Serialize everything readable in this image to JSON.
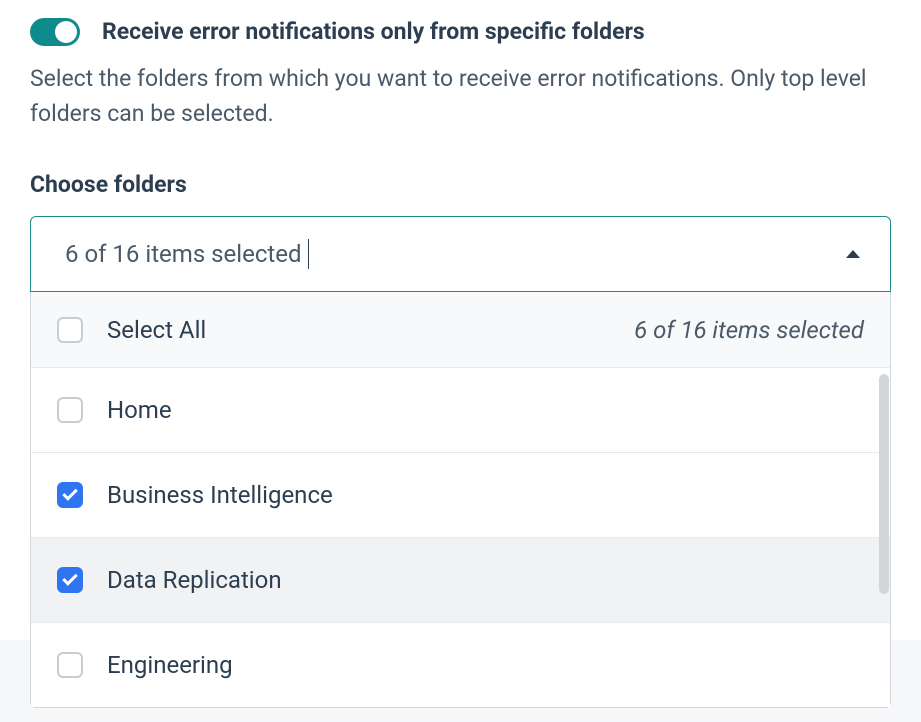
{
  "toggle": {
    "label": "Receive error notifications only from specific folders",
    "enabled": true
  },
  "description": "Select the folders from which you want to receive error notifications. Only top level folders can be selected.",
  "section_label": "Choose folders",
  "select_summary": "6 of 16 items selected",
  "dropdown": {
    "select_all_label": "Select All",
    "selected_summary": "6 of 16 items selected",
    "options": [
      {
        "label": "Home",
        "checked": false
      },
      {
        "label": "Business Intelligence",
        "checked": true
      },
      {
        "label": "Data Replication",
        "checked": true
      },
      {
        "label": "Engineering",
        "checked": false
      }
    ]
  }
}
